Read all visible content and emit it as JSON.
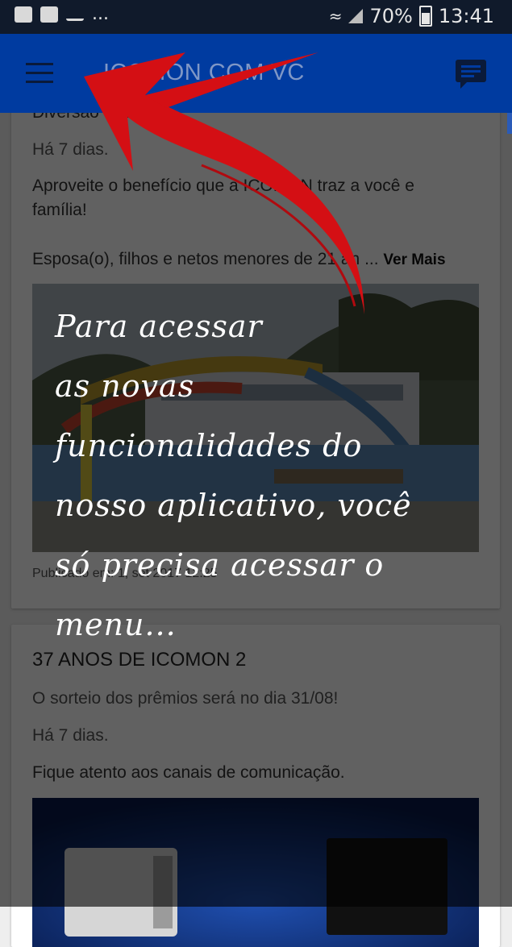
{
  "status_bar": {
    "battery": "70%",
    "time": "13:41",
    "notification_more": "..."
  },
  "app_bar": {
    "title": "ICOMON COM VC"
  },
  "feed": {
    "items": [
      {
        "title": "Diversão Garantida",
        "date": "Há 7 dias.",
        "text": "Aproveite o benefício que a ICOMON traz a você e família!",
        "excerpt": "Esposa(o), filhos e netos menores de 21 an ...",
        "more": "Ver Mais",
        "published": "Publicado em: 1, set 2017 12:25"
      },
      {
        "title": "37 ANOS DE ICOMON 2",
        "subtitle": "O sorteio dos prêmios será no dia 31/08!",
        "date": "Há 7 dias.",
        "text": "Fique atento aos canais de comunicação."
      }
    ]
  },
  "tutorial": {
    "lines": [
      "Para acessar",
      "as novas",
      "funcionalidades do",
      "nosso aplicativo, você",
      "só precisa acessar o",
      "menu..."
    ],
    "arrow_color": "#d40f14"
  }
}
